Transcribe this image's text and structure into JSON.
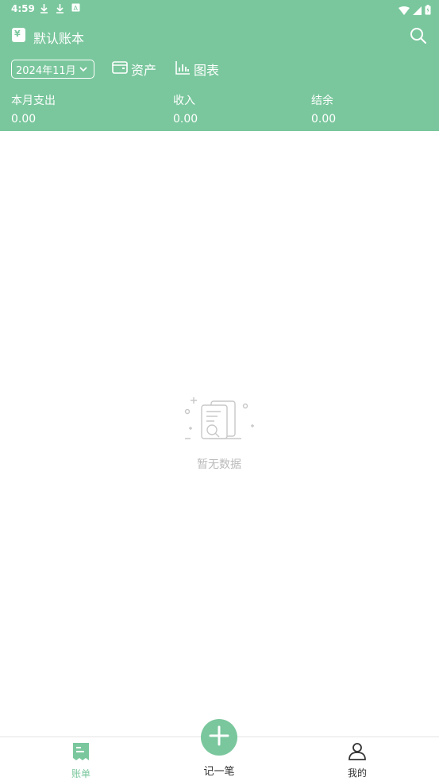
{
  "status": {
    "time": "4:59"
  },
  "title": {
    "book_name": "默认账本"
  },
  "toolbar": {
    "month": "2024年11月",
    "assets_label": "资产",
    "chart_label": "图表"
  },
  "summary": {
    "expense_label": "本月支出",
    "expense_value": "0.00",
    "income_label": "收入",
    "income_value": "0.00",
    "balance_label": "结余",
    "balance_value": "0.00"
  },
  "empty_state": {
    "text": "暂无数据"
  },
  "bottom_nav": {
    "bills_label": "账单",
    "add_label": "记一笔",
    "mine_label": "我的"
  },
  "colors": {
    "accent": "#7ac79d",
    "inactive": "#333333",
    "empty": "#bbbbbb"
  }
}
